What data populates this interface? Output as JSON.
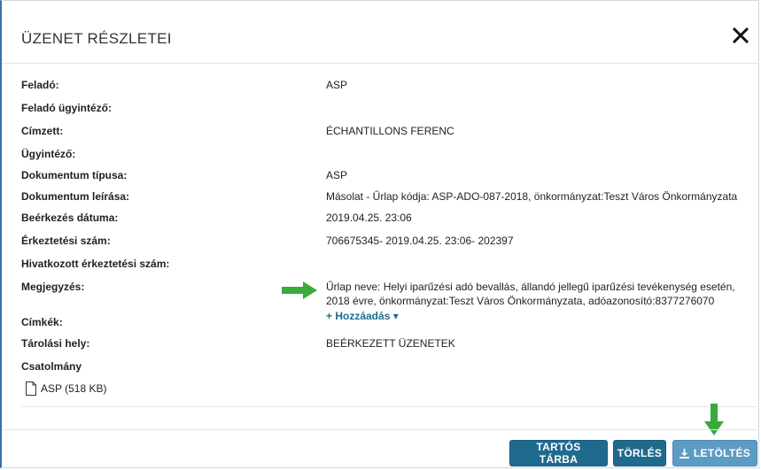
{
  "dialog": {
    "title": "ÜZENET RÉSZLETEI"
  },
  "fields": [
    {
      "label": "Feladó:",
      "value": "ASP"
    },
    {
      "label": "Feladó ügyintéző:",
      "value": ""
    },
    {
      "label": "Címzett:",
      "value": "ÉCHANTILLONS FERENC"
    },
    {
      "label": "Ügyintéző:",
      "value": ""
    },
    {
      "label": "Dokumentum típusa:",
      "value": "ASP"
    },
    {
      "label": "Dokumentum leírása:",
      "value": "Másolat - Űrlap kódja: ASP-ADO-087-2018, önkormányzat:Teszt Város Önkormányzata"
    },
    {
      "label": "Beérkezés dátuma:",
      "value": "2019.04.25. 23:06"
    },
    {
      "label": "Érkeztetési szám:",
      "value": "706675345- 2019.04.25. 23:06- 202397"
    },
    {
      "label": "Hivatkozott érkeztetési szám:",
      "value": ""
    },
    {
      "label": "Megjegyzés:",
      "value": "Űrlap neve: Helyi iparűzési adó bevallás, állandó jellegű iparűzési tevékenység esetén, 2018 évre, önkormányzat:Teszt Város Önkormányzata, adóazonosító:8377276070"
    },
    {
      "label": "Címkék:",
      "value": ""
    },
    {
      "label": "Tárolási hely:",
      "value": "BEÉRKEZETT ÜZENETEK"
    },
    {
      "label": "Csatolmány",
      "value": ""
    }
  ],
  "add_tag_link": "+ Hozzáadás ▾",
  "attachment": {
    "name": "ASP (518 KB)",
    "icon": "file-icon"
  },
  "buttons": {
    "archive": "TARTÓS TÁRBA",
    "delete": "TÖRLÉS",
    "download": "LETÖLTÉS"
  },
  "colors": {
    "primary": "#1f6b8e",
    "secondary": "#5c9cc4",
    "arrow": "#3aaa3a"
  }
}
